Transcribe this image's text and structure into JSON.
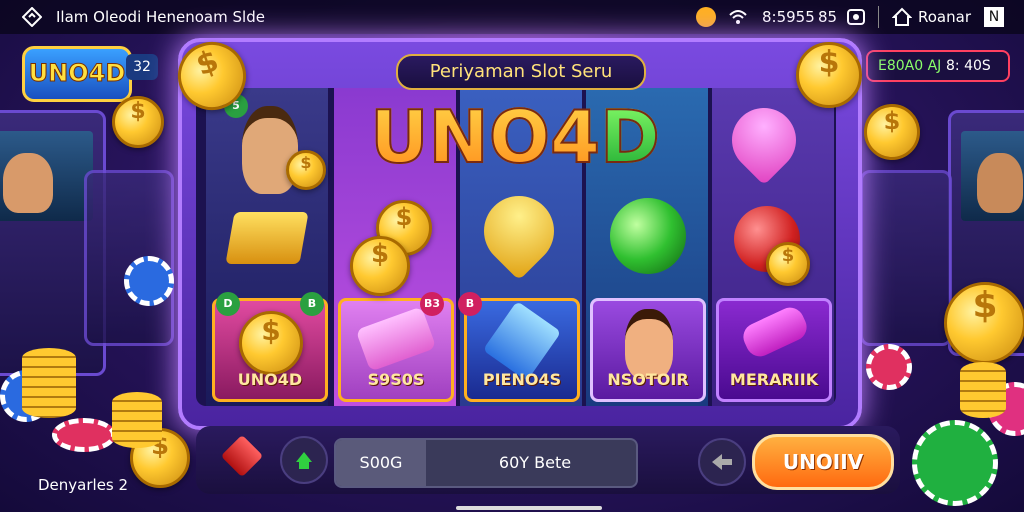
{
  "status_bar": {
    "app_title": "Ilam Oleodi Henenoam Slde",
    "time": "8:5955",
    "battery": "85",
    "account": "Roanar"
  },
  "header": {
    "logo": "UNO4D",
    "logo_badge": "32",
    "banner_title": "Periyaman Slot Seru",
    "game_title_main": "UNO4",
    "game_title_d": "D",
    "score_left": "E80A0 AJ",
    "score_right": "8: 40S"
  },
  "reels": {
    "badges": [
      "D",
      "B",
      "B3",
      "B",
      "5"
    ],
    "tiles": [
      {
        "label": "UNO4D",
        "color": "#c02a8a"
      },
      {
        "label": "S9S0S",
        "color": "#b040c0"
      },
      {
        "label": "PIENO4S",
        "color": "#1a3aa0"
      },
      {
        "label": "NSOTOIR",
        "color": "#6a2ab0"
      },
      {
        "label": "MERARIIK",
        "color": "#5a1aa0"
      }
    ]
  },
  "controls": {
    "bet_value": "S00G",
    "bet_text": "60Y Bete",
    "spin_label": "UNOIIV"
  },
  "footer": {
    "label": "Denyarles 2"
  },
  "colors": {
    "frame": "#7a4ae0",
    "spin": "#ff8a20",
    "gold": "#ffc930"
  }
}
